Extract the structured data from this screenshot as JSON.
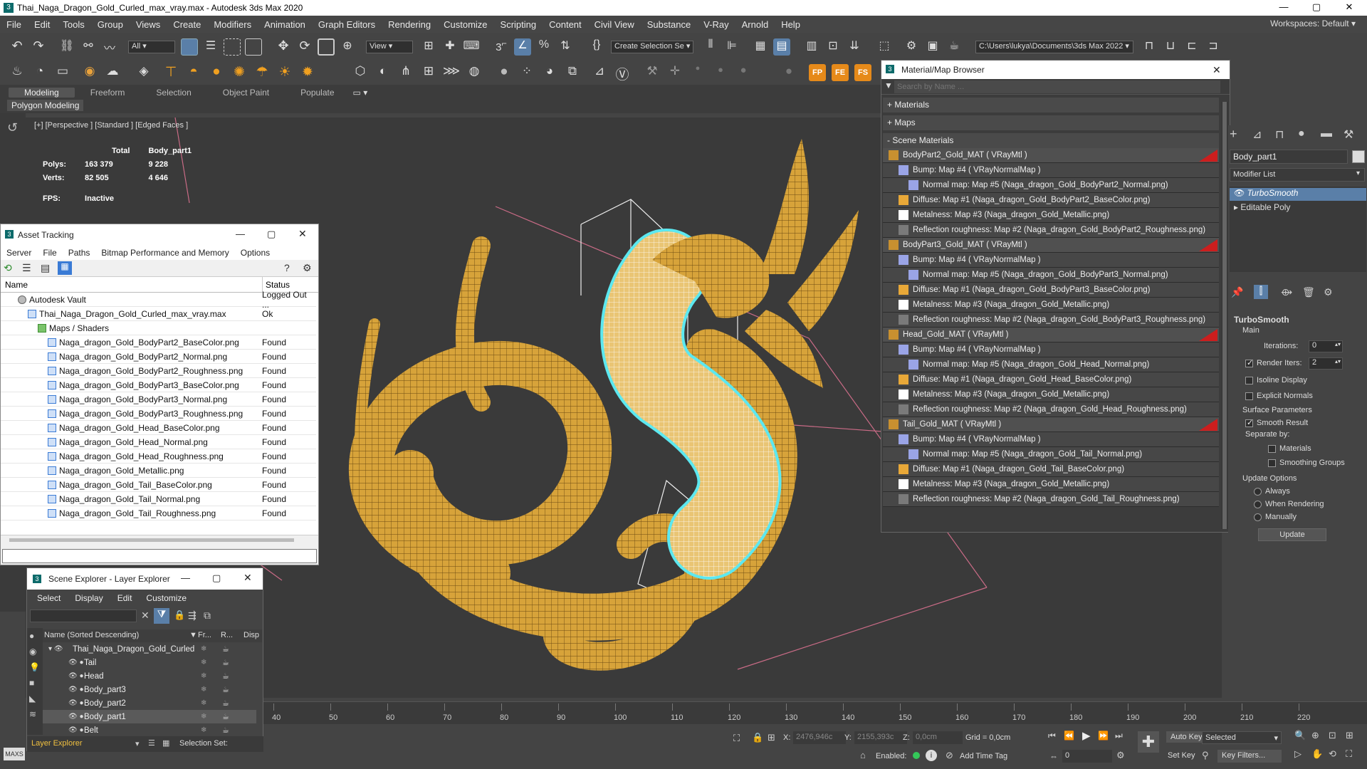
{
  "window": {
    "title": "Thai_Naga_Dragon_Gold_Curled_max_vray.max - Autodesk 3ds Max 2020",
    "minimize": "—",
    "maximize": "▢",
    "close": "✕"
  },
  "menu": {
    "items": [
      "File",
      "Edit",
      "Tools",
      "Group",
      "Views",
      "Create",
      "Modifiers",
      "Animation",
      "Graph Editors",
      "Rendering",
      "Customize",
      "Scripting",
      "Content",
      "Civil View",
      "Substance",
      "V-Ray",
      "Arnold",
      "Help"
    ],
    "workspaces_label": "Workspaces:",
    "workspaces_value": "Default"
  },
  "toolbar": {
    "filter": "All",
    "view": "View",
    "selection_set": "Create Selection Se",
    "path": "C:\\Users\\lukya\\Documents\\3ds Max 2022"
  },
  "ribbon": {
    "tabs": [
      "Modeling",
      "Freeform",
      "Selection",
      "Object Paint",
      "Populate"
    ],
    "active_tab": "Modeling",
    "sub": "Polygon Modeling"
  },
  "viewport": {
    "label": "[+] [Perspective ] [Standard ] [Edged Faces ]",
    "total_label": "Total",
    "object_label": "Body_part1",
    "polys_label": "Polys:",
    "polys_total": "163 379",
    "polys_obj": "9 228",
    "verts_label": "Verts:",
    "verts_total": "82 505",
    "verts_obj": "4 646",
    "fps_label": "FPS:",
    "fps_value": "Inactive"
  },
  "asset_tracking": {
    "title": "Asset Tracking",
    "menu": [
      "Server",
      "File",
      "Paths",
      "Bitmap Performance and Memory",
      "Options"
    ],
    "col_name": "Name",
    "col_status": "Status",
    "rows": [
      {
        "name": "Autodesk Vault",
        "status": "Logged Out ...",
        "indent": 0
      },
      {
        "name": "Thai_Naga_Dragon_Gold_Curled_max_vray.max",
        "status": "Ok",
        "indent": 1
      },
      {
        "name": "Maps / Shaders",
        "status": "",
        "indent": 2
      },
      {
        "name": "Naga_dragon_Gold_BodyPart2_BaseColor.png",
        "status": "Found",
        "indent": 3
      },
      {
        "name": "Naga_dragon_Gold_BodyPart2_Normal.png",
        "status": "Found",
        "indent": 3
      },
      {
        "name": "Naga_dragon_Gold_BodyPart2_Roughness.png",
        "status": "Found",
        "indent": 3
      },
      {
        "name": "Naga_dragon_Gold_BodyPart3_BaseColor.png",
        "status": "Found",
        "indent": 3
      },
      {
        "name": "Naga_dragon_Gold_BodyPart3_Normal.png",
        "status": "Found",
        "indent": 3
      },
      {
        "name": "Naga_dragon_Gold_BodyPart3_Roughness.png",
        "status": "Found",
        "indent": 3
      },
      {
        "name": "Naga_dragon_Gold_Head_BaseColor.png",
        "status": "Found",
        "indent": 3
      },
      {
        "name": "Naga_dragon_Gold_Head_Normal.png",
        "status": "Found",
        "indent": 3
      },
      {
        "name": "Naga_dragon_Gold_Head_Roughness.png",
        "status": "Found",
        "indent": 3
      },
      {
        "name": "Naga_dragon_Gold_Metallic.png",
        "status": "Found",
        "indent": 3
      },
      {
        "name": "Naga_dragon_Gold_Tail_BaseColor.png",
        "status": "Found",
        "indent": 3
      },
      {
        "name": "Naga_dragon_Gold_Tail_Normal.png",
        "status": "Found",
        "indent": 3
      },
      {
        "name": "Naga_dragon_Gold_Tail_Roughness.png",
        "status": "Found",
        "indent": 3
      }
    ]
  },
  "material_browser": {
    "title": "Material/Map Browser",
    "search_placeholder": "Search by Name ...",
    "sections": [
      "+ Materials",
      "+ Maps",
      "- Scene Materials"
    ],
    "rows": [
      {
        "text": "BodyPart2_Gold_MAT ( VRayMtl )",
        "kind": "mat"
      },
      {
        "text": "Bump: Map #4 ( VRayNormalMap )",
        "kind": "bump"
      },
      {
        "text": "Normal map: Map #5 (Naga_dragon_Gold_BodyPart2_Normal.png)",
        "kind": "normal"
      },
      {
        "text": "Diffuse: Map #1 (Naga_dragon_Gold_BodyPart2_BaseColor.png)",
        "kind": "diffuse"
      },
      {
        "text": "Metalness: Map #3 (Naga_dragon_Gold_Metallic.png)",
        "kind": "metal"
      },
      {
        "text": "Reflection roughness: Map #2 (Naga_dragon_Gold_BodyPart2_Roughness.png)",
        "kind": "rough"
      },
      {
        "text": "BodyPart3_Gold_MAT ( VRayMtl )",
        "kind": "mat"
      },
      {
        "text": "Bump: Map #4 ( VRayNormalMap )",
        "kind": "bump"
      },
      {
        "text": "Normal map: Map #5 (Naga_dragon_Gold_BodyPart3_Normal.png)",
        "kind": "normal"
      },
      {
        "text": "Diffuse: Map #1 (Naga_dragon_Gold_BodyPart3_BaseColor.png)",
        "kind": "diffuse"
      },
      {
        "text": "Metalness: Map #3 (Naga_dragon_Gold_Metallic.png)",
        "kind": "metal"
      },
      {
        "text": "Reflection roughness: Map #2 (Naga_dragon_Gold_BodyPart3_Roughness.png)",
        "kind": "rough"
      },
      {
        "text": "Head_Gold_MAT ( VRayMtl )",
        "kind": "mat"
      },
      {
        "text": "Bump: Map #4 ( VRayNormalMap )",
        "kind": "bump"
      },
      {
        "text": "Normal map: Map #5 (Naga_dragon_Gold_Head_Normal.png)",
        "kind": "normal"
      },
      {
        "text": "Diffuse: Map #1 (Naga_dragon_Gold_Head_BaseColor.png)",
        "kind": "diffuse"
      },
      {
        "text": "Metalness: Map #3 (Naga_dragon_Gold_Metallic.png)",
        "kind": "metal"
      },
      {
        "text": "Reflection roughness: Map #2 (Naga_dragon_Gold_Head_Roughness.png)",
        "kind": "rough"
      },
      {
        "text": "Tail_Gold_MAT ( VRayMtl )",
        "kind": "mat"
      },
      {
        "text": "Bump: Map #4 ( VRayNormalMap )",
        "kind": "bump"
      },
      {
        "text": "Normal map: Map #5 (Naga_dragon_Gold_Tail_Normal.png)",
        "kind": "normal"
      },
      {
        "text": "Diffuse: Map #1 (Naga_dragon_Gold_Tail_BaseColor.png)",
        "kind": "diffuse"
      },
      {
        "text": "Metalness: Map #3 (Naga_dragon_Gold_Metallic.png)",
        "kind": "metal"
      },
      {
        "text": "Reflection roughness: Map #2 (Naga_dragon_Gold_Tail_Roughness.png)",
        "kind": "rough"
      }
    ]
  },
  "command_panel": {
    "object_name": "Body_part1",
    "modifier_list": "Modifier List",
    "stack": [
      "TurboSmooth",
      "Editable Poly"
    ],
    "rollout": "TurboSmooth",
    "main": "Main",
    "iterations_label": "Iterations:",
    "iterations": "0",
    "render_iters_label": "Render Iters:",
    "render_iters": "2",
    "isoline": "Isoline Display",
    "explicit": "Explicit Normals",
    "surface": "Surface Parameters",
    "smooth_result": "Smooth Result",
    "separate_by": "Separate by:",
    "materials": "Materials",
    "smoothing_groups": "Smoothing Groups",
    "update_options": "Update Options",
    "always": "Always",
    "when_rendering": "When Rendering",
    "manually": "Manually",
    "update": "Update"
  },
  "scene_explorer": {
    "title": "Scene Explorer - Layer Explorer",
    "menu": [
      "Select",
      "Display",
      "Edit",
      "Customize"
    ],
    "col_name": "Name (Sorted Descending)",
    "col_fr": "Fr...",
    "col_r": "R...",
    "col_disp": "Disp",
    "root": "Thai_Naga_Dragon_Gold_Curled",
    "items": [
      "Tail",
      "Head",
      "Body_part3",
      "Body_part2",
      "Body_part1",
      "Belt"
    ],
    "selected": "Body_part1",
    "footer": "Layer Explorer",
    "selection_set": "Selection Set:"
  },
  "timeline": {
    "ticks": [
      "40",
      "50",
      "60",
      "70",
      "80",
      "90",
      "100",
      "110",
      "120",
      "130",
      "140",
      "150",
      "160",
      "170",
      "180",
      "190",
      "200",
      "210",
      "220"
    ]
  },
  "statusbar": {
    "x_label": "X:",
    "x": "2476,946c",
    "y_label": "Y:",
    "y": "2155,393c",
    "z_label": "Z:",
    "z": "0,0cm",
    "grid": "Grid = 0,0cm",
    "enabled": "Enabled:",
    "add_time_tag": "Add Time Tag",
    "auto_key": "Auto Key",
    "selected": "Selected",
    "set_key": "Set Key",
    "key_filters": "Key Filters...",
    "frame": "0",
    "maxs": "MAXS"
  },
  "colors": {
    "gold": "#d7a33a",
    "selection": "#5ce8f0",
    "red_tag": "#cc1e1e"
  }
}
